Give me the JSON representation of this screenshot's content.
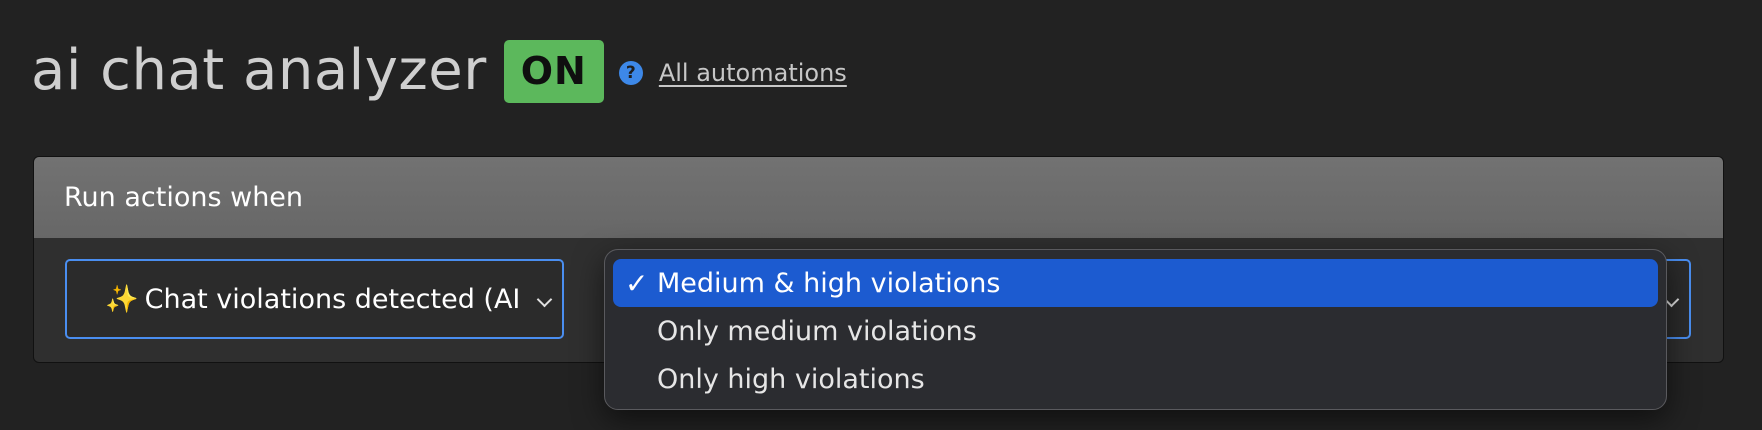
{
  "header": {
    "title": "ai chat analyzer",
    "status": "ON",
    "help_icon": "?",
    "all_link": "All automations"
  },
  "panel": {
    "title": "Run actions when",
    "trigger": {
      "icon": "✨",
      "value": "Chat violations detected (AI"
    }
  },
  "dropdown": {
    "check_glyph": "✓",
    "options": [
      {
        "label": "Medium & high violations",
        "selected": true
      },
      {
        "label": "Only medium violations",
        "selected": false
      },
      {
        "label": "Only high violations",
        "selected": false
      }
    ]
  },
  "colors": {
    "background": "#222222",
    "status_on": "#5cb85c",
    "accent": "#4a8ef0",
    "selection": "#1c5bd0"
  }
}
